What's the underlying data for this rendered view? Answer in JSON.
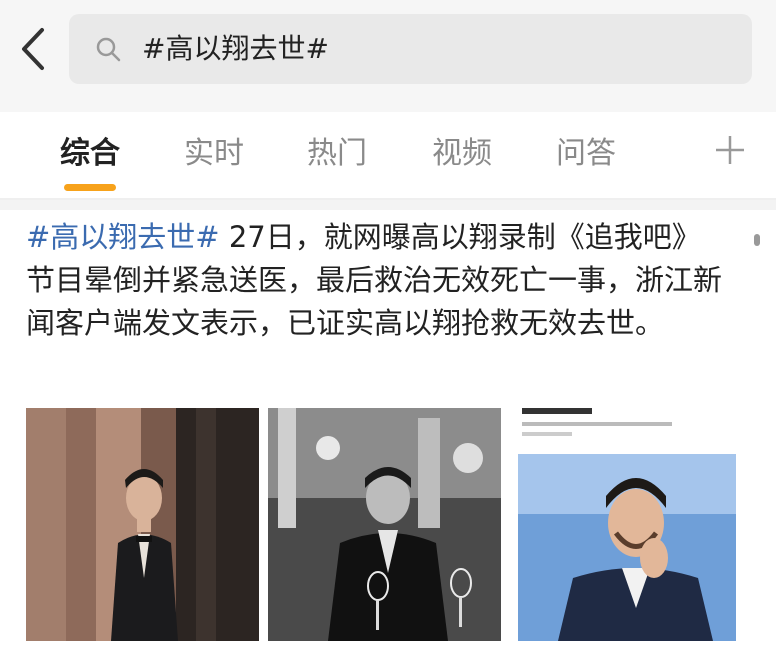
{
  "search": {
    "query": "#高以翔去世#"
  },
  "tabs": [
    {
      "label": "综合",
      "active": true
    },
    {
      "label": "实时"
    },
    {
      "label": "热门"
    },
    {
      "label": "视频"
    },
    {
      "label": "问答"
    }
  ],
  "post": {
    "hashtag": "#高以翔去世#",
    "body": " 27日，就网曝高以翔录制《追我吧》节目晕倒并紧急送医，最后救治无效死亡一事，浙江新闻客户端发文表示，已证实高以翔抢救无效去世。"
  },
  "colors": {
    "accent": "#f7a21b",
    "link": "#3b6bb0",
    "header_bg": "#f6f6f6",
    "search_bg": "#e9e9e9"
  },
  "icons": [
    "back-arrow-icon",
    "search-icon",
    "plus-icon"
  ]
}
